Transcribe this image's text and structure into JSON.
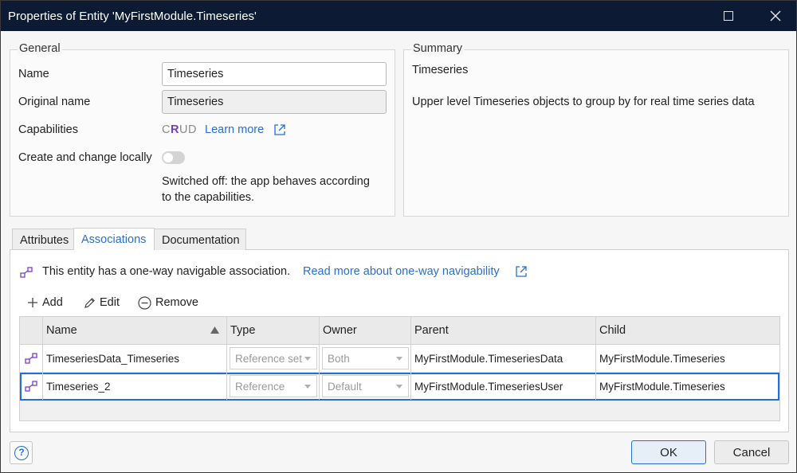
{
  "window": {
    "title": "Properties of Entity 'MyFirstModule.Timeseries'"
  },
  "general": {
    "legend": "General",
    "name_label": "Name",
    "name_value": "Timeseries",
    "original_name_label": "Original name",
    "original_name_value": "Timeseries",
    "capabilities_label": "Capabilities",
    "crud": {
      "c": "C",
      "r": "R",
      "u": "U",
      "d": "D"
    },
    "learn_more": "Learn more",
    "create_local_label": "Create and change locally",
    "toggle_on": false,
    "switched_off_text_1": "Switched off: the app behaves according",
    "switched_off_text_2": "to the capabilities."
  },
  "summary": {
    "legend": "Summary",
    "title": "Timeseries",
    "description": "Upper level Timeseries objects to group by for real time series data"
  },
  "tabs": [
    {
      "label": "Attributes"
    },
    {
      "label": "Associations"
    },
    {
      "label": "Documentation"
    }
  ],
  "associations": {
    "info_text": "This entity has a one-way navigable association.",
    "info_link": "Read more about one-way navigability",
    "toolbar": {
      "add": "Add",
      "edit": "Edit",
      "remove": "Remove"
    },
    "columns": [
      "Name",
      "Type",
      "Owner",
      "Parent",
      "Child"
    ],
    "rows": [
      {
        "name": "TimeseriesData_Timeseries",
        "type": "Reference set",
        "owner": "Both",
        "parent": "MyFirstModule.TimeseriesData",
        "child": "MyFirstModule.Timeseries"
      },
      {
        "name": "Timeseries_2",
        "type": "Reference",
        "owner": "Default",
        "parent": "MyFirstModule.TimeseriesUser",
        "child": "MyFirstModule.Timeseries"
      }
    ],
    "selected_row": 1
  },
  "footer": {
    "ok": "OK",
    "cancel": "Cancel",
    "help": "?"
  },
  "colors": {
    "titlebar": "#0c1b33",
    "accent": "#2a6fc9",
    "selection": "#1f6fe0",
    "crud_read": "#6b3fc7"
  }
}
